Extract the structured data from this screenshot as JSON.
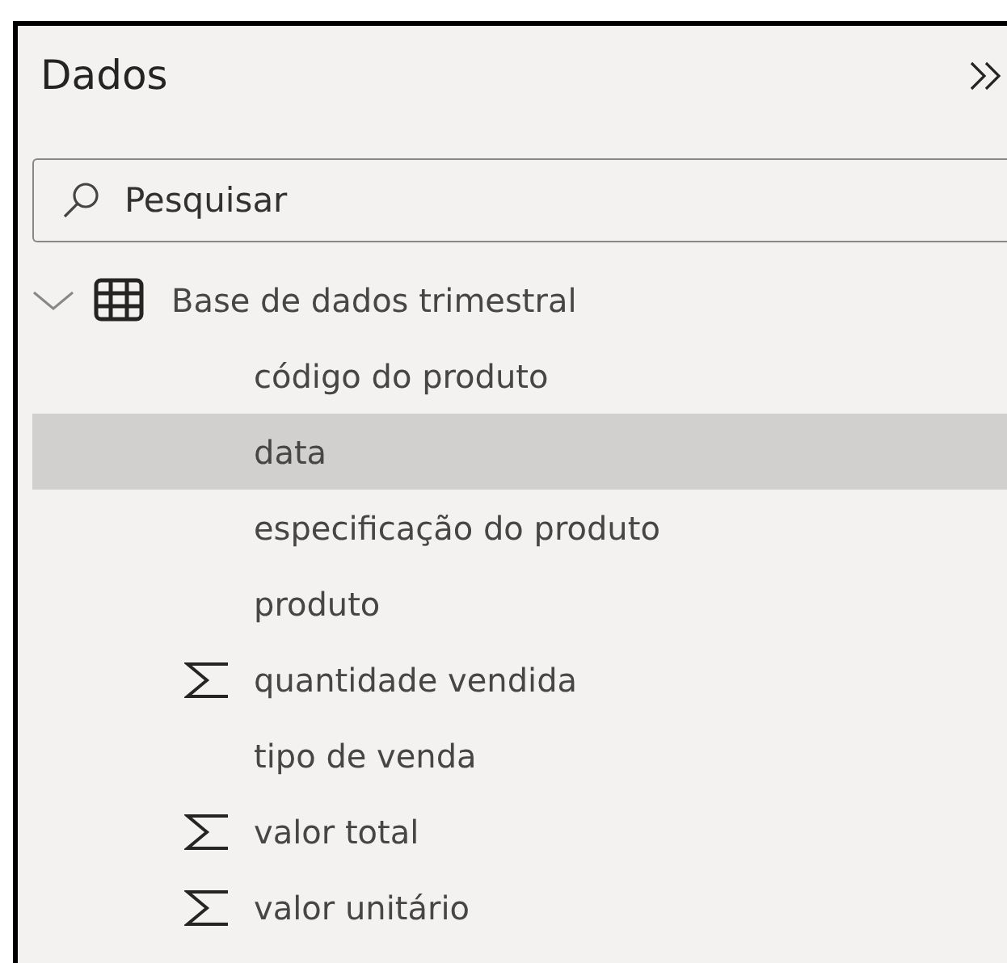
{
  "panel": {
    "title": "Dados"
  },
  "search": {
    "placeholder": "Pesquisar"
  },
  "tree": [
    {
      "label": "Base de dados trimestral",
      "expanded": true,
      "children": [
        {
          "label": "código do produto",
          "kind": "plain",
          "selected": false
        },
        {
          "label": "data",
          "kind": "plain",
          "selected": true
        },
        {
          "label": "especificação do produto",
          "kind": "plain",
          "selected": false
        },
        {
          "label": "produto",
          "kind": "plain",
          "selected": false
        },
        {
          "label": "quantidade vendida",
          "kind": "measure",
          "selected": false
        },
        {
          "label": "tipo de venda",
          "kind": "plain",
          "selected": false
        },
        {
          "label": "valor total",
          "kind": "measure",
          "selected": false
        },
        {
          "label": "valor unitário",
          "kind": "measure",
          "selected": false
        }
      ]
    }
  ]
}
